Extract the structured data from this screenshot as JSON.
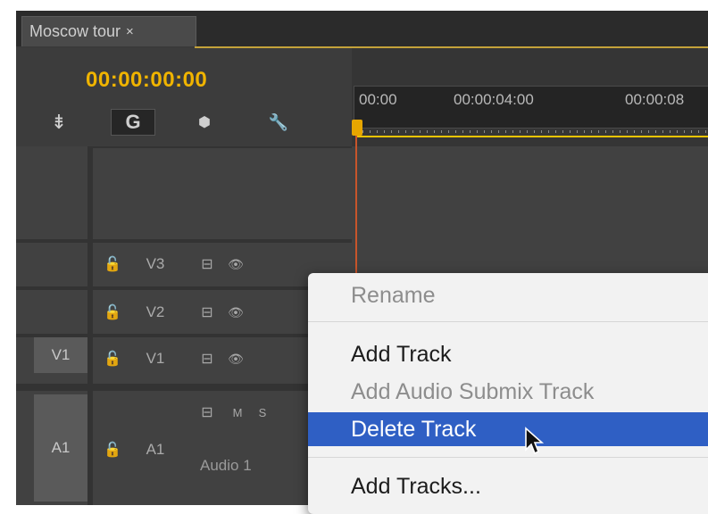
{
  "tab": {
    "title": "Moscow tour",
    "close": "×"
  },
  "header": {
    "timecode": "00:00:00:00",
    "tools": [
      {
        "name": "insert-sequence-icon",
        "glyph": "⇟"
      },
      {
        "name": "snap-icon",
        "glyph": "G"
      },
      {
        "name": "add-marker-icon",
        "glyph": "⬢"
      },
      {
        "name": "settings-wrench-icon",
        "glyph": "🔧"
      }
    ],
    "ruler": [
      "00:00",
      "00:00:04:00",
      "00:00:08"
    ]
  },
  "tracks": {
    "video": [
      {
        "label": "V3",
        "source": ""
      },
      {
        "label": "V2",
        "source": ""
      },
      {
        "label": "V1",
        "source": "V1"
      }
    ],
    "audio": [
      {
        "label": "A1",
        "source": "A1",
        "mute": "M",
        "solo": "S",
        "name": "Audio 1"
      }
    ],
    "lock_glyph": "🔓",
    "sync_glyph": "⊟",
    "eye_glyph": "👁"
  },
  "context_menu": {
    "items": [
      {
        "label": "Rename",
        "state": "disabled"
      },
      {
        "label": "Add Track",
        "state": "enabled"
      },
      {
        "label": "Add Audio Submix Track",
        "state": "disabled"
      },
      {
        "label": "Delete Track",
        "state": "highlighted"
      },
      {
        "label": "Add Tracks...",
        "state": "enabled"
      }
    ]
  },
  "colors": {
    "timecode": "#f0b400",
    "playhead": "#e7a600",
    "menu_highlight": "#2f5fc4"
  }
}
